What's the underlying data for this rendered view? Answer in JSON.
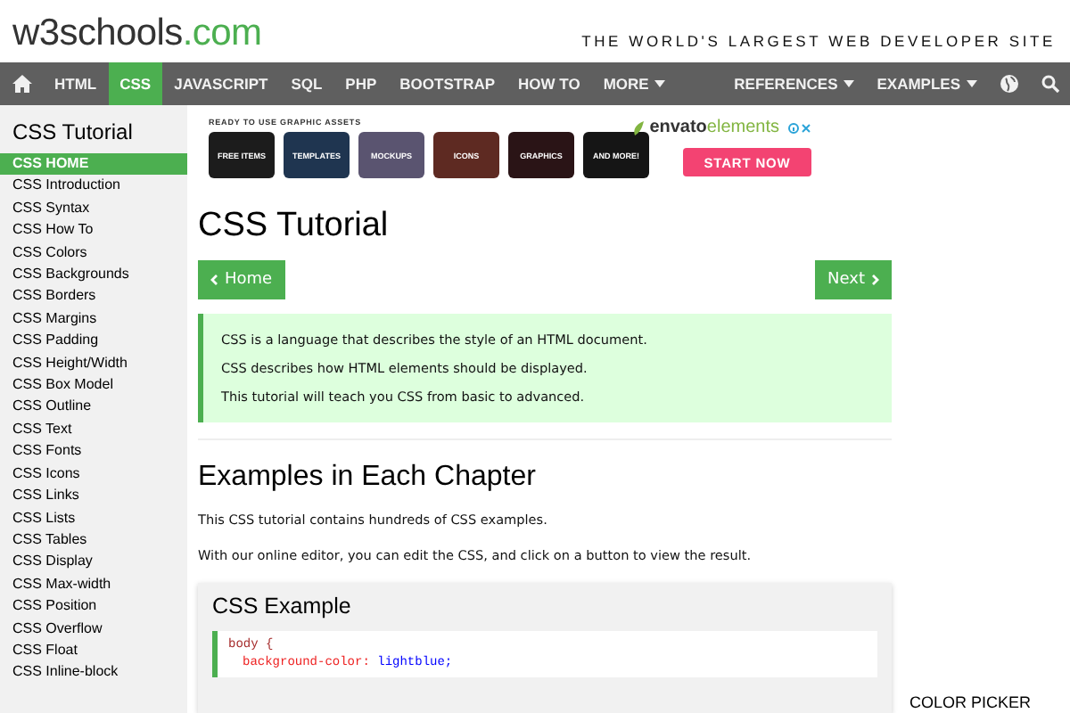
{
  "header": {
    "logo_name": "w3schools",
    "logo_suffix": ".com",
    "tagline": "THE WORLD'S LARGEST WEB DEVELOPER SITE"
  },
  "nav": [
    {
      "kind": "home",
      "selected": false
    },
    {
      "kind": "text",
      "label": "HTML",
      "selected": false
    },
    {
      "kind": "text",
      "label": "CSS",
      "selected": true
    },
    {
      "kind": "text",
      "label": "JAVASCRIPT",
      "selected": false
    },
    {
      "kind": "text",
      "label": "SQL",
      "selected": false
    },
    {
      "kind": "text",
      "label": "PHP",
      "selected": false
    },
    {
      "kind": "text",
      "label": "BOOTSTRAP",
      "selected": false
    },
    {
      "kind": "text",
      "label": "HOW TO",
      "selected": false
    },
    {
      "kind": "dropdown",
      "label": "MORE",
      "selected": false
    },
    {
      "kind": "spacer"
    },
    {
      "kind": "dropdown",
      "label": "REFERENCES",
      "selected": false
    },
    {
      "kind": "dropdown",
      "label": "EXAMPLES",
      "selected": false
    },
    {
      "kind": "globe",
      "selected": false
    },
    {
      "kind": "search",
      "selected": false
    }
  ],
  "sidebar": {
    "title": "CSS Tutorial",
    "items": [
      {
        "label": "CSS HOME",
        "selected": true
      },
      {
        "label": "CSS Introduction",
        "selected": false
      },
      {
        "label": "CSS Syntax",
        "selected": false
      },
      {
        "label": "CSS How To",
        "selected": false
      },
      {
        "label": "CSS Colors",
        "selected": false
      },
      {
        "label": "CSS Backgrounds",
        "selected": false
      },
      {
        "label": "CSS Borders",
        "selected": false
      },
      {
        "label": "CSS Margins",
        "selected": false
      },
      {
        "label": "CSS Padding",
        "selected": false
      },
      {
        "label": "CSS Height/Width",
        "selected": false
      },
      {
        "label": "CSS Box Model",
        "selected": false
      },
      {
        "label": "CSS Outline",
        "selected": false
      },
      {
        "label": "CSS Text",
        "selected": false
      },
      {
        "label": "CSS Fonts",
        "selected": false
      },
      {
        "label": "CSS Icons",
        "selected": false
      },
      {
        "label": "CSS Links",
        "selected": false
      },
      {
        "label": "CSS Lists",
        "selected": false
      },
      {
        "label": "CSS Tables",
        "selected": false
      },
      {
        "label": "CSS Display",
        "selected": false
      },
      {
        "label": "CSS Max-width",
        "selected": false
      },
      {
        "label": "CSS Position",
        "selected": false
      },
      {
        "label": "CSS Overflow",
        "selected": false
      },
      {
        "label": "CSS Float",
        "selected": false
      },
      {
        "label": "CSS Inline-block",
        "selected": false
      }
    ]
  },
  "ad": {
    "caption": "READY TO USE GRAPHIC ASSETS",
    "tiles": [
      {
        "label": "FREE ITEMS",
        "color": "#1c1c1c"
      },
      {
        "label": "TEMPLATES",
        "color": "#1f3550"
      },
      {
        "label": "MOCKUPS",
        "color": "#5a5470"
      },
      {
        "label": "ICONS",
        "color": "#5e2a22"
      },
      {
        "label": "GRAPHICS",
        "color": "#2a1416"
      },
      {
        "label": "AND MORE!",
        "color": "#151515"
      }
    ],
    "brand": "envato",
    "brand_suffix": "elements",
    "cta": "START NOW"
  },
  "page": {
    "title": "CSS Tutorial",
    "prev_button": "Home",
    "next_button": "Next",
    "note": [
      "CSS is a language that describes the style of an HTML document.",
      "CSS describes how HTML elements should be displayed.",
      "This tutorial will teach you CSS from basic to advanced."
    ],
    "section_title": "Examples in Each Chapter",
    "paragraphs": [
      "This CSS tutorial contains hundreds of CSS examples.",
      "With our online editor, you can edit the CSS, and click on a button to view the result."
    ],
    "example": {
      "title": "CSS Example",
      "code": [
        {
          "selector": "body {"
        },
        {
          "property": "background-color:",
          "value": "lightblue;"
        }
      ]
    }
  },
  "right_panel": {
    "heading": "COLOR PICKER"
  }
}
